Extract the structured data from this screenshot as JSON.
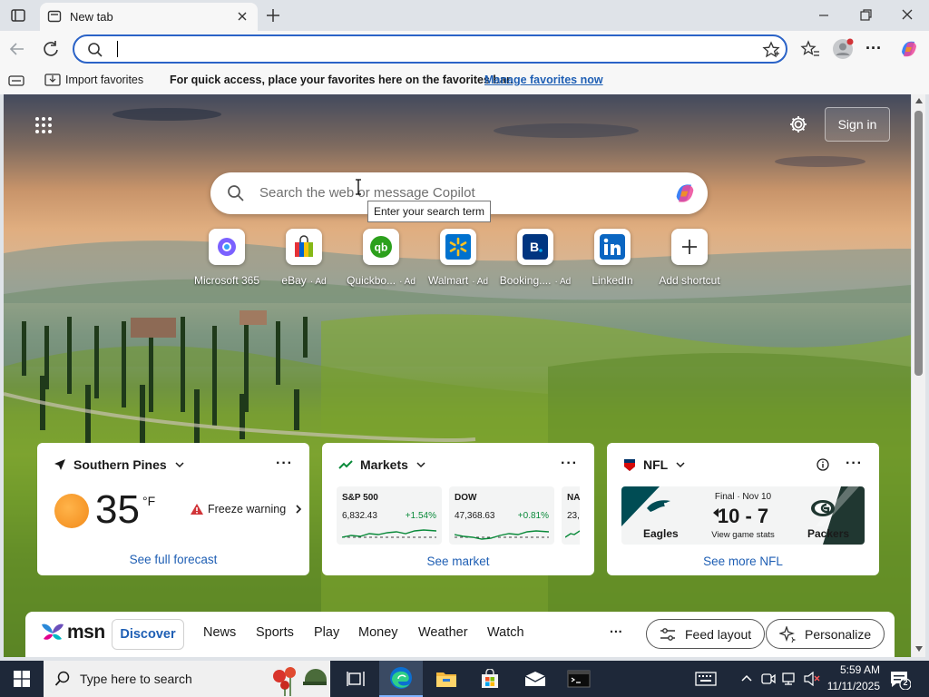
{
  "browser": {
    "tab_title": "New tab",
    "address_value": "",
    "favorites_bar": {
      "import_label": "Import favorites",
      "message": "For quick access, place your favorites here on the favorites bar.",
      "manage_link": "Manage favorites now"
    }
  },
  "newtab": {
    "sign_in": "Sign in",
    "search_placeholder": "Search the web or message Copilot",
    "tooltip": "Enter your search term",
    "quick_links": [
      {
        "label": "Microsoft 365",
        "ad": ""
      },
      {
        "label": "eBay",
        "ad": "Ad"
      },
      {
        "label": "Quickbo...",
        "ad": "Ad"
      },
      {
        "label": "Walmart",
        "ad": "Ad"
      },
      {
        "label": "Booking....",
        "ad": "Ad"
      },
      {
        "label": "LinkedIn",
        "ad": ""
      },
      {
        "label": "Add shortcut",
        "ad": ""
      }
    ],
    "weather": {
      "location": "Southern Pines",
      "temp": "35",
      "unit": "°F",
      "alert": "Freeze warning",
      "link": "See full forecast"
    },
    "markets": {
      "title": "Markets",
      "tickers": [
        {
          "name": "S&P 500",
          "value": "6,832.43",
          "change": "+1.54%"
        },
        {
          "name": "DOW",
          "value": "47,368.63",
          "change": "+0.81%"
        },
        {
          "name": "NA",
          "value": "23,",
          "change": ""
        }
      ],
      "link": "See market"
    },
    "nfl": {
      "title": "NFL",
      "status": "Final · Nov 10",
      "score": "10 - 7",
      "sub": "View game stats",
      "home": "Eagles",
      "away": "Packers",
      "link": "See more NFL"
    },
    "msn": {
      "logo": "msn",
      "tabs": [
        "Discover",
        "News",
        "Sports",
        "Play",
        "Money",
        "Weather",
        "Watch"
      ],
      "more": "···",
      "feed_layout": "Feed layout",
      "personalize": "Personalize"
    }
  },
  "taskbar": {
    "search_placeholder": "Type here to search",
    "time": "5:59 AM",
    "date": "11/11/2025",
    "notifications": "2"
  },
  "colors": {
    "accent": "#2b63c7",
    "link": "#1f5fb4",
    "positive": "#0a8a3a",
    "taskbar": "#1e2839"
  }
}
